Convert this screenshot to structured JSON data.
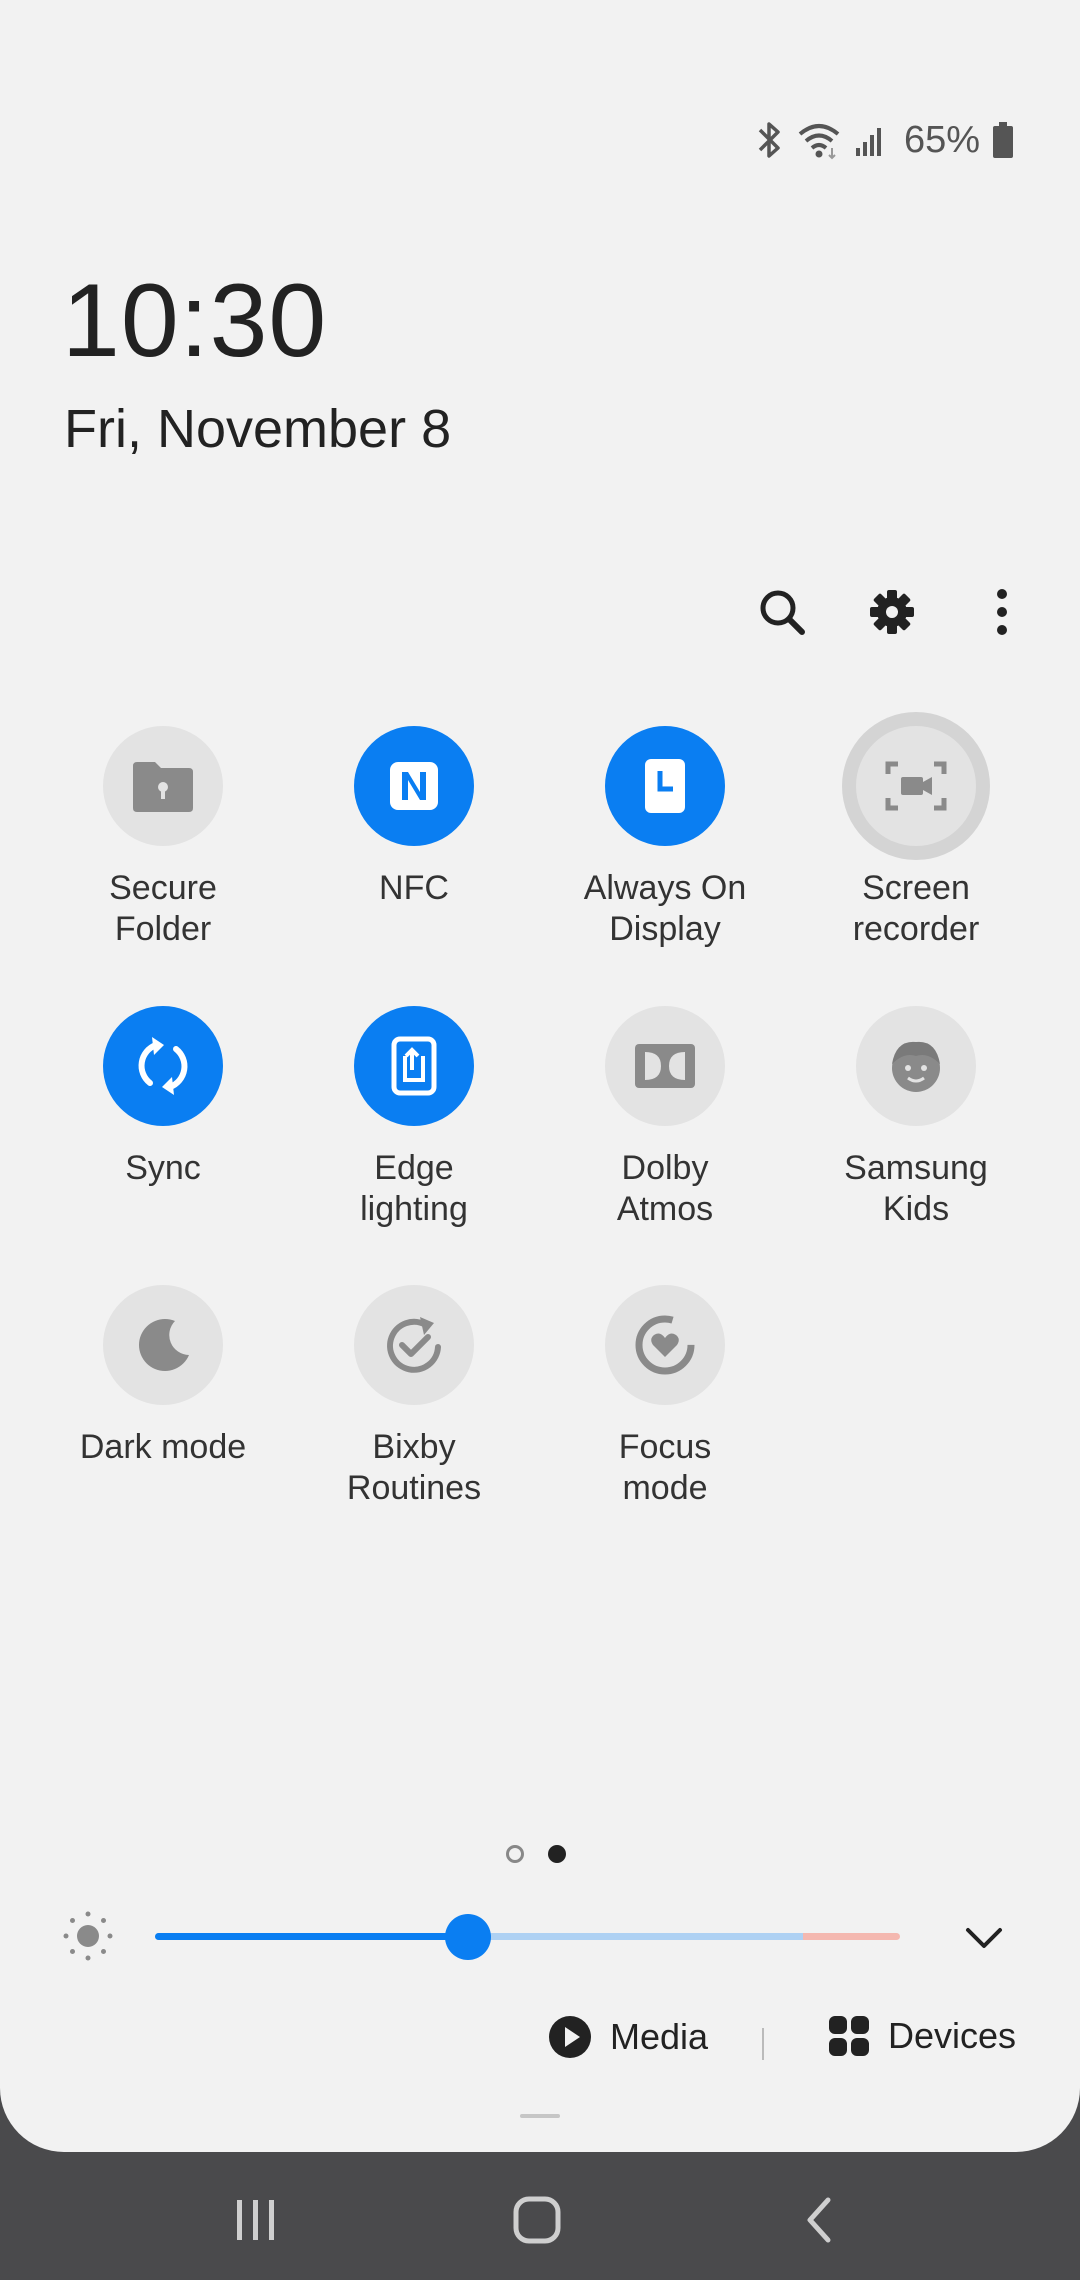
{
  "status_bar": {
    "icons": [
      "bluetooth-icon",
      "wifi-icon",
      "signal-icon",
      "battery-icon"
    ],
    "battery_percent": "65%"
  },
  "clock": {
    "time": "10:30",
    "date": "Fri, November 8"
  },
  "toolbar": {
    "icons": [
      "search-icon",
      "gear-icon",
      "more-vert-icon"
    ]
  },
  "tiles": [
    {
      "label": "Secure\nFolder",
      "icon": "secure-folder-icon",
      "state": "off"
    },
    {
      "label": "NFC",
      "icon": "nfc-icon",
      "state": "on"
    },
    {
      "label": "Always On\nDisplay",
      "icon": "always-on-display-icon",
      "state": "on"
    },
    {
      "label": "Screen\nrecorder",
      "icon": "screen-recorder-icon",
      "state": "off"
    },
    {
      "label": "Sync",
      "icon": "sync-icon",
      "state": "on"
    },
    {
      "label": "Edge\nlighting",
      "icon": "edge-lighting-icon",
      "state": "on"
    },
    {
      "label": "Dolby\nAtmos",
      "icon": "dolby-icon",
      "state": "off"
    },
    {
      "label": "Samsung\nKids",
      "icon": "samsung-kids-icon",
      "state": "off"
    },
    {
      "label": "Dark mode",
      "icon": "moon-icon",
      "state": "off"
    },
    {
      "label": "Bixby\nRoutines",
      "icon": "bixby-routines-icon",
      "state": "off"
    },
    {
      "label": "Focus\nmode",
      "icon": "focus-mode-icon",
      "state": "off"
    }
  ],
  "pager": {
    "pages": 2,
    "current": 2
  },
  "brightness": {
    "level": 0.42,
    "icon": "brightness-icon"
  },
  "media": {
    "label": "Media",
    "icon": "play-icon"
  },
  "devices": {
    "label": "Devices",
    "icon": "devices-icon"
  },
  "navigation": {
    "icons": [
      "recents-icon",
      "home-icon",
      "back-icon"
    ]
  },
  "colors": {
    "accent": "#0a7ef2",
    "panel": "#f2f2f2",
    "nav_bar": "#4a4a4c",
    "tile_off": "#e3e3e3",
    "icon_off": "#8a8a8a"
  }
}
